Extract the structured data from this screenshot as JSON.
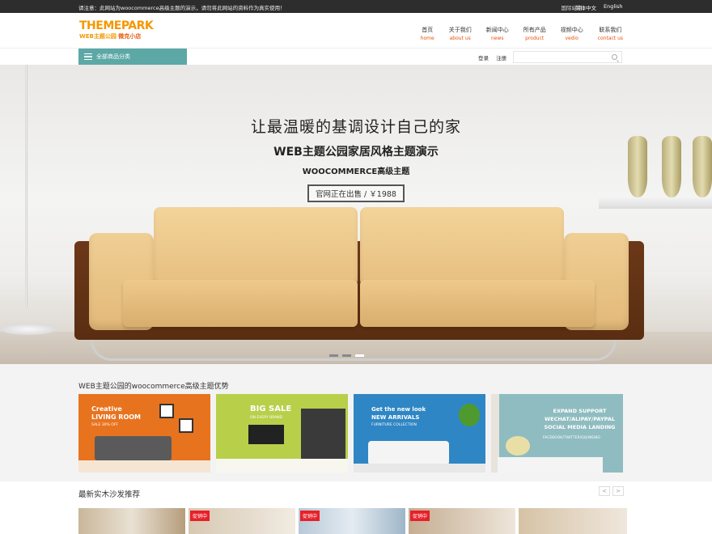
{
  "topbar": {
    "notice": "请注意：此网站为woocommerce高级主题的演示，请勿将此网站的资料作为真实使用！",
    "site_label": "国际站点：",
    "lang_cn": "简体中文",
    "lang_en": "English"
  },
  "logo": {
    "main": "THEMEPARK",
    "sub": "WEB主题公园",
    "shop": "微克小店"
  },
  "nav": [
    {
      "zh": "首页",
      "en": "home"
    },
    {
      "zh": "关于我们",
      "en": "about us"
    },
    {
      "zh": "新闻中心",
      "en": "news"
    },
    {
      "zh": "所有产品",
      "en": "product"
    },
    {
      "zh": "视频中心",
      "en": "vedio"
    },
    {
      "zh": "联系我们",
      "en": "contact us"
    }
  ],
  "category_button": "全部商品分类",
  "auth": {
    "login": "登录",
    "register": "注册"
  },
  "search": {
    "placeholder": ""
  },
  "hero": {
    "line1": "让最温暖的基调设计自己的家",
    "line2": "WEB主题公园家居风格主题演示",
    "line3": "WOOCOMMERCE高级主题",
    "price": "官网正在出售 / ￥1988",
    "slide_count": 3,
    "active_slide": 3
  },
  "advantages": {
    "title": "WEB主题公园的woocommerce高级主题优势",
    "tiles": [
      {
        "title": "Creative LIVING ROOM",
        "sub": "SALE 30% OFF",
        "color": "#e8731f"
      },
      {
        "title": "BIG SALE",
        "sub": "ON EVERY BRAND",
        "color": "#b8cf4a"
      },
      {
        "title": "Get the new look NEW ARRIVALS",
        "sub": "FURNITURE COLLECTION",
        "color": "#2f86c4"
      },
      {
        "title": "EXPAND SUPPORT WECHAT/ALIPAY/PAYPAL SOCIAL MEDIA LANDING",
        "sub": "FACEBOOK/TWITTER/QQ/WEIBO",
        "color": "#8fbcc0"
      }
    ]
  },
  "latest": {
    "title": "最新实木沙发推荐",
    "prev": "<",
    "next": ">",
    "badge": "促销中"
  }
}
